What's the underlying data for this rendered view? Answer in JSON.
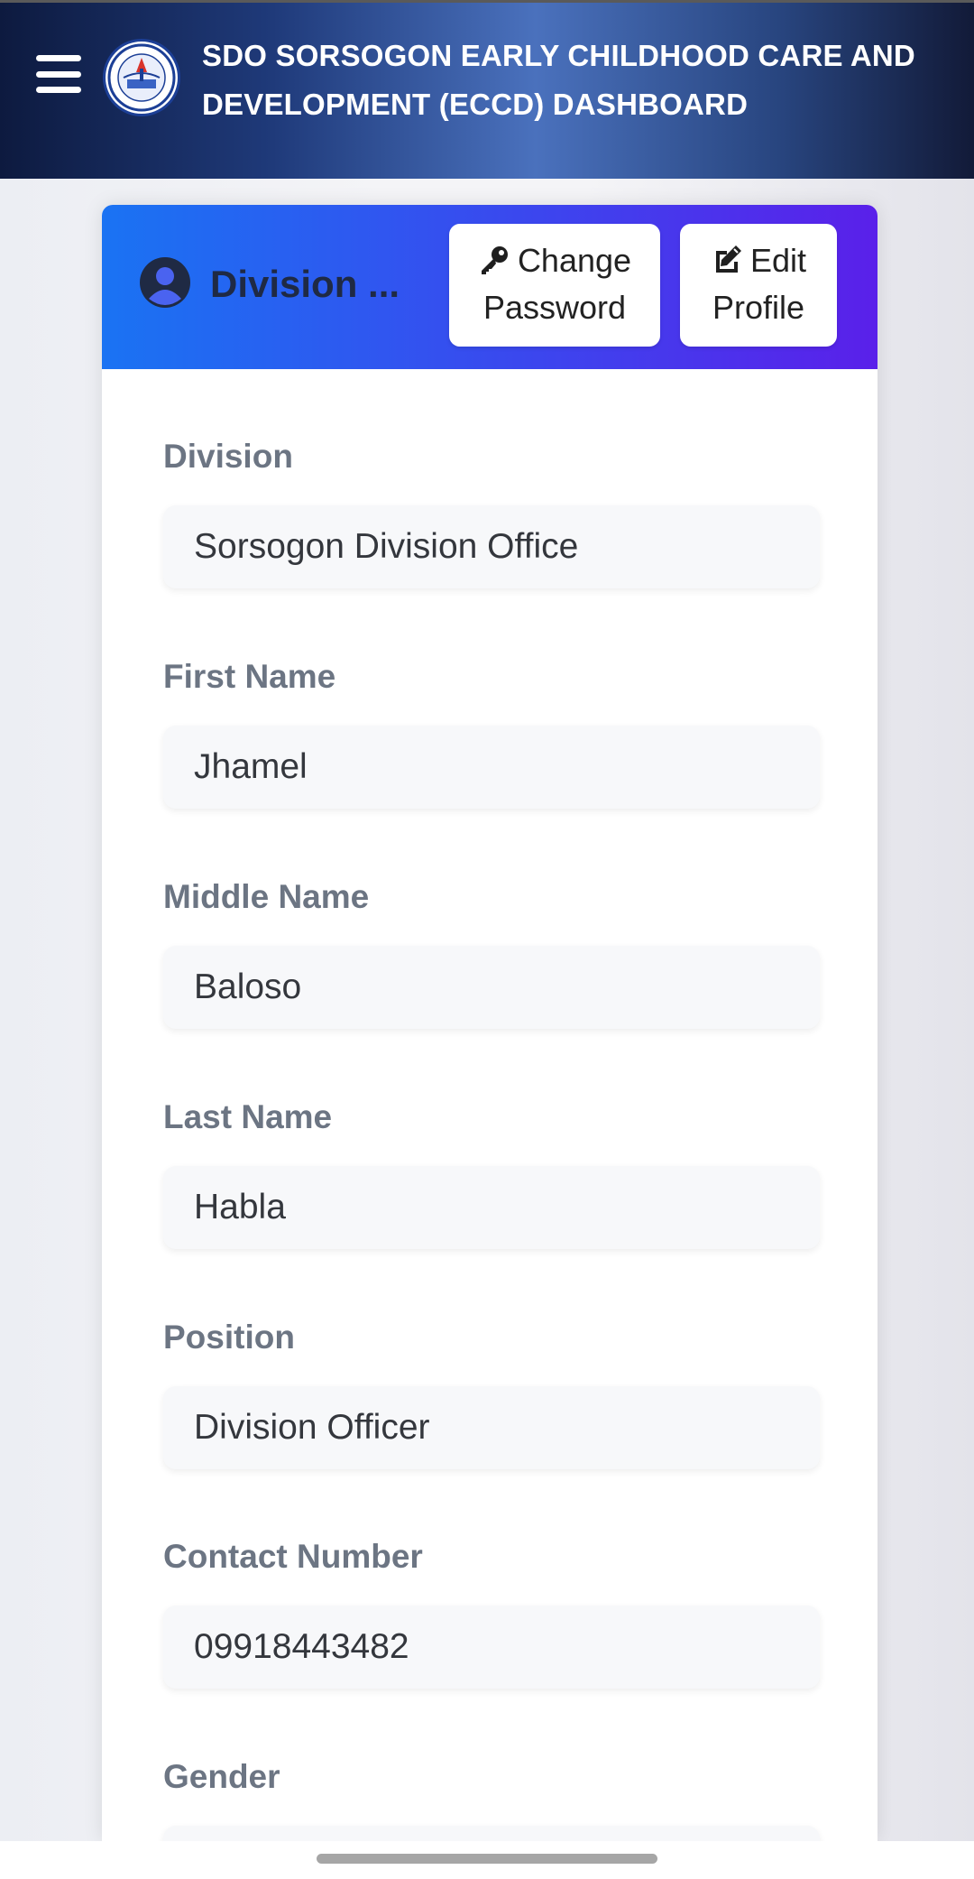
{
  "header": {
    "title": "SDO SORSOGON EARLY CHILDHOOD CARE AND DEVELOPMENT (ECCD) DASHBOARD",
    "menu_icon": "hamburger-menu-icon",
    "logo": "deped-seal-logo"
  },
  "profile_card": {
    "title": "Division ...",
    "user_icon": "user-circle-icon",
    "change_password": {
      "icon": "key-icon",
      "label_line1": "Change",
      "label_line2": "Password"
    },
    "edit_profile": {
      "icon": "edit-square-icon",
      "label_line1": "Edit",
      "label_line2": "Profile"
    }
  },
  "fields": {
    "division": {
      "label": "Division",
      "value": "Sorsogon Division Office"
    },
    "first_name": {
      "label": "First Name",
      "value": "Jhamel"
    },
    "middle_name": {
      "label": "Middle Name",
      "value": "Baloso"
    },
    "last_name": {
      "label": "Last Name",
      "value": "Habla"
    },
    "position": {
      "label": "Position",
      "value": "Division Officer"
    },
    "contact_number": {
      "label": "Contact Number",
      "value": "09918443482"
    },
    "gender": {
      "label": "Gender",
      "value": ""
    }
  },
  "colors": {
    "header_dark": "#0d1a3f",
    "header_mid": "#4a71bd",
    "card_head_start": "#1a73f3",
    "card_head_end": "#5a20ea",
    "label_gray": "#6c7583"
  }
}
